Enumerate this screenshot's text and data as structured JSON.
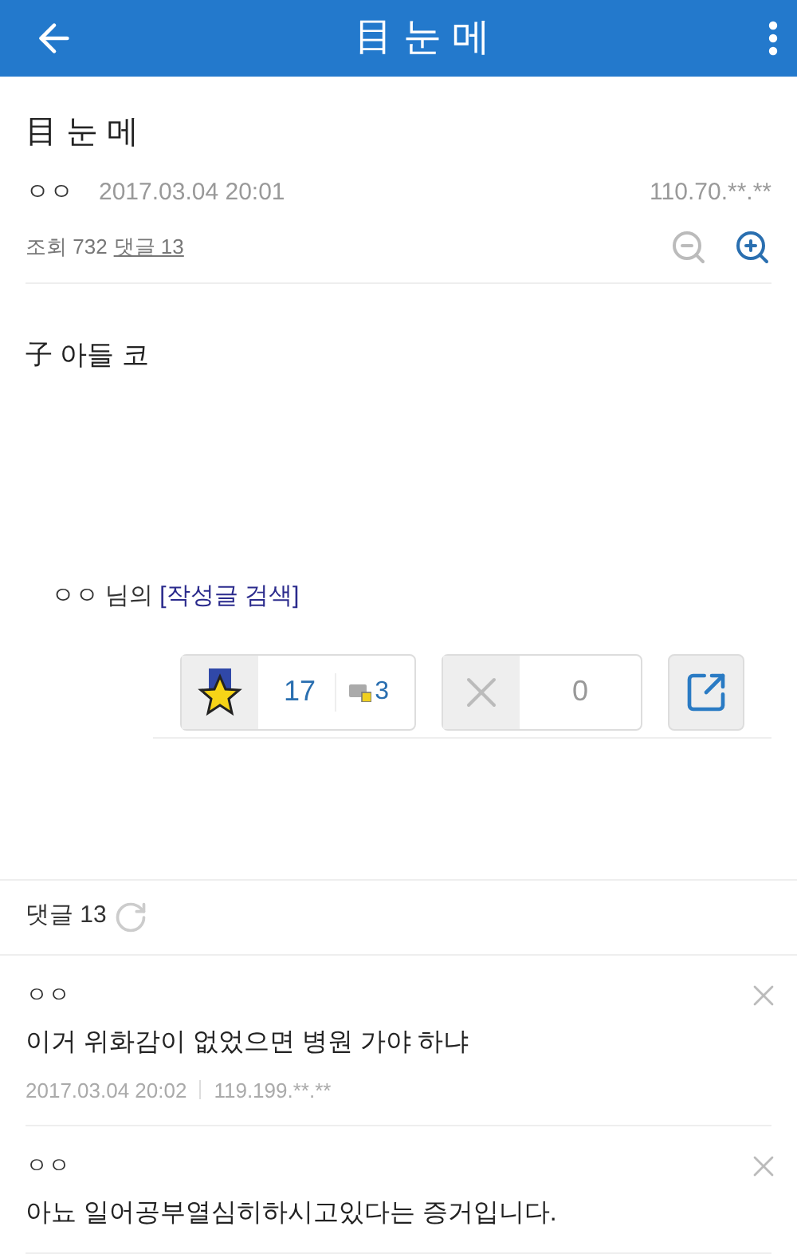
{
  "app_bar": {
    "title": "目 눈 메"
  },
  "post": {
    "title": "目 눈 메",
    "author": "ㅇㅇ",
    "date": "2017.03.04 20:01",
    "ip": "110.70.**.**",
    "views_label": "조회 732",
    "comments_link": "댓글 13",
    "body": "子 아들 코"
  },
  "author_line": {
    "author": "ㅇㅇ 님의",
    "link": "[작성글 검색]"
  },
  "votes": {
    "up": "17",
    "fixed_up": "3",
    "down": "0"
  },
  "comments_header": {
    "label": "댓글 13"
  },
  "comments": [
    {
      "author": "ㅇㅇ",
      "text": "이거 위화감이 없었으면 병원 가야 하냐",
      "date": "2017.03.04 20:02",
      "ip": "119.199.**.**"
    },
    {
      "author": "ㅇㅇ",
      "text": "아뇨 일어공부열심히하시고있다는 증거입니다."
    }
  ]
}
